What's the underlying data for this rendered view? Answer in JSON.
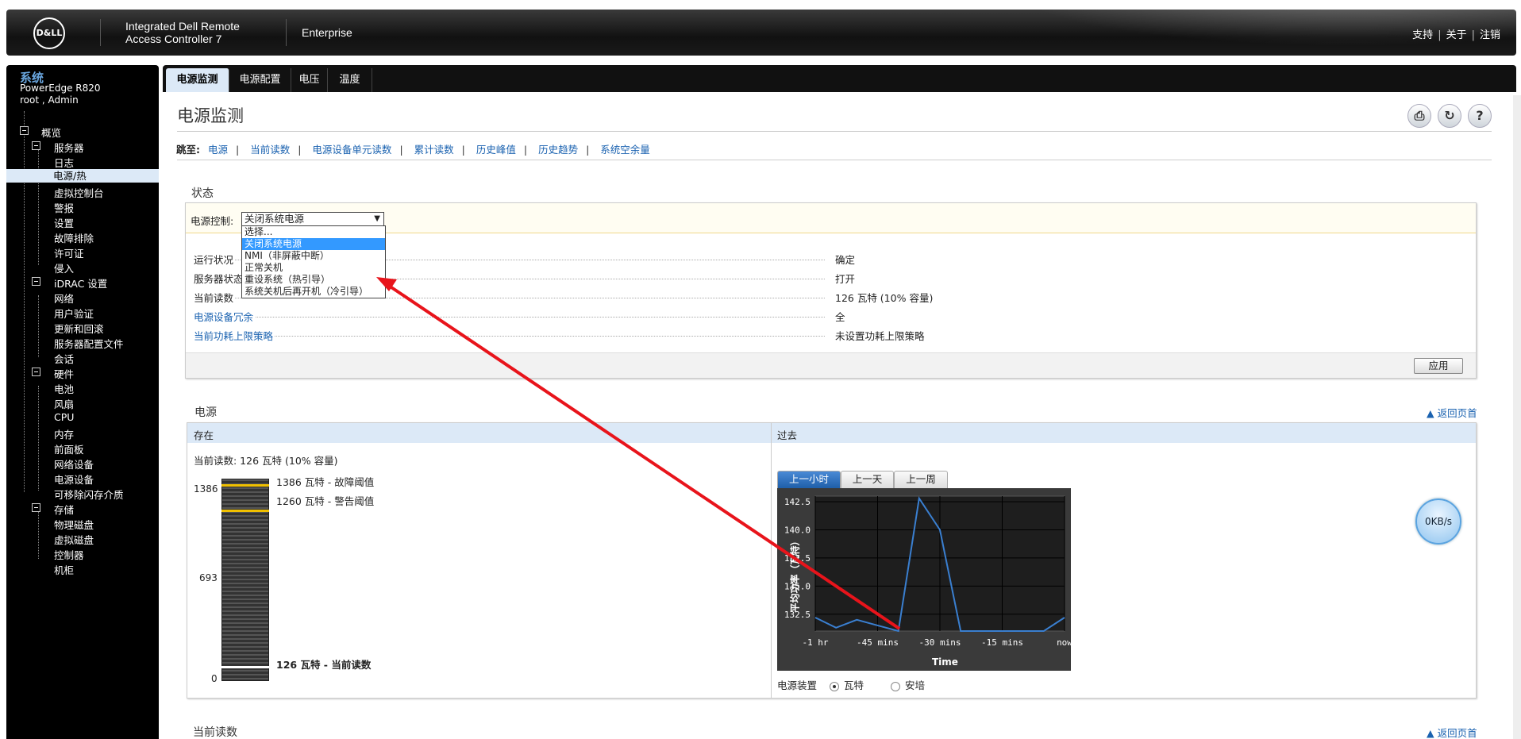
{
  "header": {
    "logo_text": "D&LL",
    "product_line1": "Integrated Dell Remote",
    "product_line2": "Access Controller 7",
    "edition": "Enterprise",
    "links": [
      "支持",
      "关于",
      "注销"
    ]
  },
  "sidebar": {
    "title": "系统",
    "model": "PowerEdge R820",
    "user": "root , Admin",
    "tree": {
      "overview": "概览",
      "server": "服务器",
      "server_items": [
        "日志",
        "电源/热",
        "虚拟控制台",
        "警报",
        "设置",
        "故障排除",
        "许可证",
        "侵入"
      ],
      "idrac": "iDRAC 设置",
      "idrac_items": [
        "网络",
        "用户验证",
        "更新和回滚",
        "服务器配置文件",
        "会话"
      ],
      "hardware": "硬件",
      "hardware_items": [
        "电池",
        "风扇",
        "CPU",
        "内存",
        "前面板",
        "网络设备",
        "电源设备",
        "可移除闪存介质"
      ],
      "storage": "存储",
      "storage_items": [
        "物理磁盘",
        "虚拟磁盘",
        "控制器",
        "机柜"
      ]
    }
  },
  "tabs": [
    "电源监测",
    "电源配置",
    "电压",
    "温度"
  ],
  "page": {
    "title": "电源监测",
    "jump_label": "跳至:",
    "jump_links": [
      "电源",
      "当前读数",
      "电源设备单元读数",
      "累计读数",
      "历史峰值",
      "历史趋势",
      "系统空余量"
    ]
  },
  "status": {
    "section_title": "状态",
    "power_control_label": "电源控制:",
    "power_control_value": "关闭系统电源",
    "dropdown_options": [
      "选择...",
      "关闭系统电源",
      "NMI（非屏蔽中断）",
      "正常关机",
      "重设系统（热引导）",
      "系统关机后再开机（冷引导）"
    ],
    "rows": [
      {
        "key": "运行状况",
        "value": "确定"
      },
      {
        "key": "服务器状态",
        "value": "打开"
      },
      {
        "key": "当前读数",
        "value": "126 瓦特 (10% 容量)"
      },
      {
        "key": "电源设备冗余",
        "value": "全"
      },
      {
        "key": "当前功耗上限策略",
        "value": "未设置功耗上限策略"
      }
    ],
    "apply_label": "应用"
  },
  "power": {
    "section_title": "电源",
    "back_to_top": "▲ 返回页首",
    "present_label": "存在",
    "past_label": "过去",
    "current_reading": "当前读数: 126 瓦特 (10% 容量)",
    "gauge_ticks": [
      "1386",
      "693",
      "0"
    ],
    "legend_failure": "1386 瓦特 - 故障阈值",
    "legend_warning": "1260 瓦特 - 警告阈值",
    "legend_current": "126 瓦特 - 当前读数",
    "gauge": {
      "max": 1386,
      "failure": 1386,
      "warning": 1260,
      "current": 126
    },
    "range_tabs": [
      "上一小时",
      "上一天",
      "上一周"
    ],
    "unit_label": "电源装置",
    "unit_options": [
      "瓦特",
      "安培"
    ]
  },
  "chart_data": {
    "type": "line",
    "xlabel": "Time",
    "ylabel": "平均功率（瓦特）",
    "x_ticks": [
      "-1 hr",
      "-45 mins",
      "-30 mins",
      "-15 mins",
      "now"
    ],
    "y_ticks": [
      "142.5",
      "140.0",
      "137.5",
      "135.0",
      "132.5"
    ],
    "ylim": [
      131.0,
      143.0
    ],
    "x": [
      -60,
      -55,
      -50,
      -45,
      -40,
      -35,
      -30,
      -25,
      -20,
      -15,
      -10,
      -5,
      0
    ],
    "series": [
      {
        "values": [
          132.2,
          131.3,
          132.0,
          131.5,
          131.0,
          142.8,
          140.0,
          131.0,
          131.0,
          131.0,
          131.0,
          131.0,
          132.2
        ]
      }
    ],
    "colors": {
      "line": "#3a7fd0",
      "background": "#1e1e1e",
      "grid": "#555555"
    }
  },
  "current_section_title": "当前读数",
  "net_speed": "0KB/s",
  "toolbar_icons": [
    "print-icon",
    "refresh-icon",
    "help-icon"
  ]
}
